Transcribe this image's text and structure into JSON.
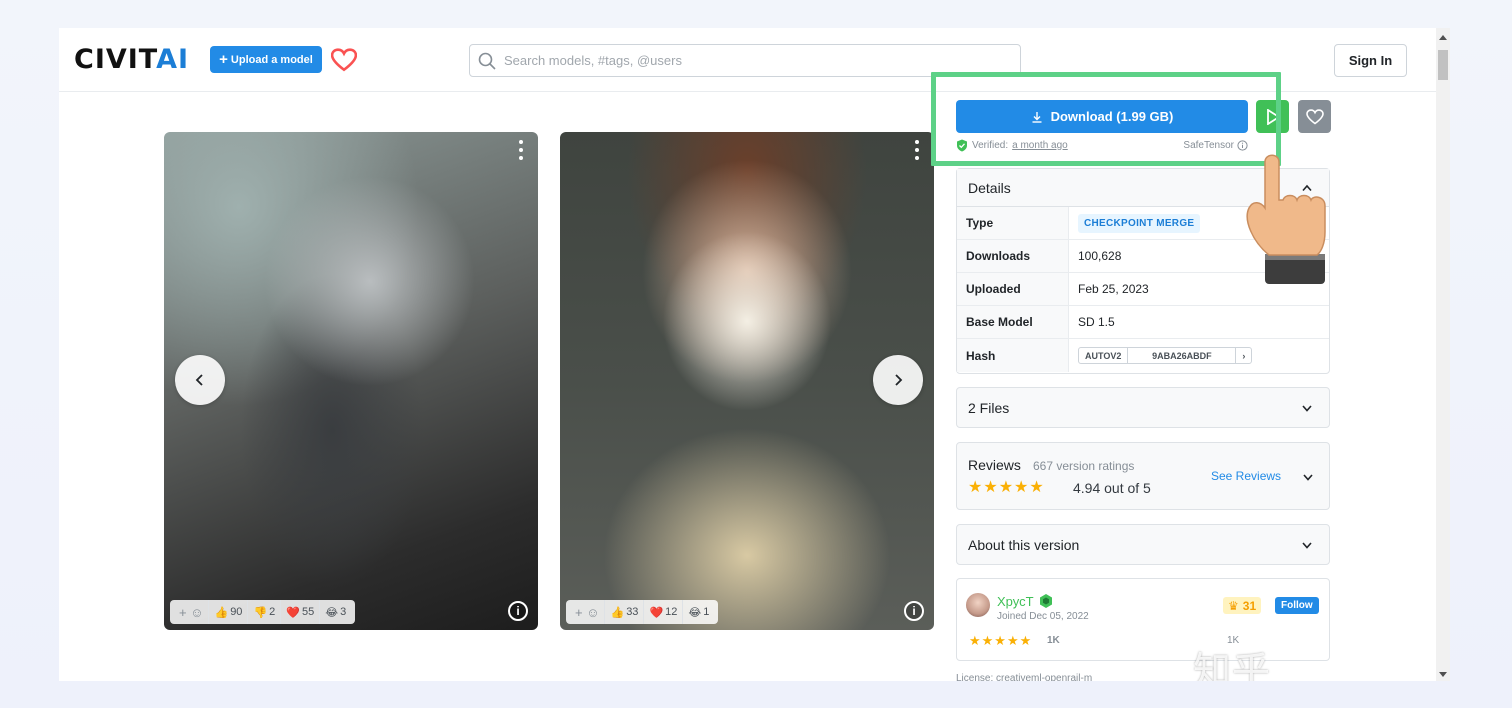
{
  "header": {
    "logo_main": "CIVIT",
    "logo_accent": "AI",
    "upload_label": "Upload a model",
    "search_placeholder": "Search models, #tags, @users",
    "signin_label": "Sign In"
  },
  "gallery": {
    "cards": [
      {
        "reactions": [
          {
            "icon": "thumbs-up",
            "glyph": "👍",
            "count": "90"
          },
          {
            "icon": "thumbs-down",
            "glyph": "👎",
            "count": "2"
          },
          {
            "icon": "heart",
            "glyph": "❤️",
            "count": "55"
          },
          {
            "icon": "laugh",
            "glyph": "😂",
            "count": "3"
          }
        ]
      },
      {
        "reactions": [
          {
            "icon": "thumbs-up",
            "glyph": "👍",
            "count": "33"
          },
          {
            "icon": "heart",
            "glyph": "❤️",
            "count": "12"
          },
          {
            "icon": "laugh",
            "glyph": "😂",
            "count": "1"
          }
        ]
      }
    ]
  },
  "download": {
    "label": "Download (1.99 GB)",
    "verified_prefix": "Verified:",
    "verified_when": "a month ago",
    "safetensor_label": "SafeTensor"
  },
  "details": {
    "title": "Details",
    "rows": {
      "type": {
        "key": "Type",
        "value": "CHECKPOINT MERGE"
      },
      "downloads": {
        "key": "Downloads",
        "value": "100,628"
      },
      "uploaded": {
        "key": "Uploaded",
        "value": "Feb 25, 2023"
      },
      "base_model": {
        "key": "Base Model",
        "value": "SD 1.5"
      },
      "hash": {
        "key": "Hash",
        "type": "AUTOV2",
        "value": "9ABA26ABDF"
      }
    }
  },
  "files": {
    "title": "2 Files"
  },
  "reviews": {
    "title": "Reviews",
    "count_text": "667 version ratings",
    "rating_text": "4.94 out of 5",
    "stars": "★★★★★",
    "see_reviews": "See Reviews"
  },
  "about": {
    "title": "About this version"
  },
  "creator": {
    "name": "ХрусТ",
    "joined": "Joined Dec 05, 2022",
    "crown_count": "31",
    "follow_label": "Follow",
    "stars": "★★★★★",
    "rating_count": "1K",
    "extra_stat": "1K"
  },
  "license_text": "License: creativeml-openrail-m",
  "watermark": "知乎 @Wincy.Fu",
  "colors": {
    "primary": "#228be6",
    "success": "#40c057",
    "highlight": "#5dd187",
    "star": "#fab005"
  }
}
